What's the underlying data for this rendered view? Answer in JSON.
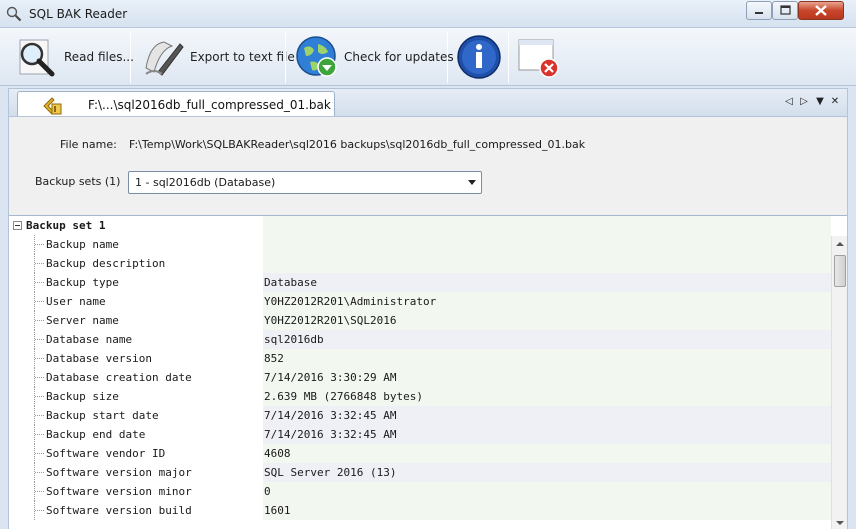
{
  "window": {
    "title": "SQL BAK Reader",
    "app_icon": "magnifier-icon"
  },
  "toolbar": {
    "read_files": "Read files...",
    "export": "Export to text file",
    "check_updates": "Check for updates"
  },
  "tab": {
    "label": "F:\\...\\sql2016db_full_compressed_01.bak"
  },
  "file": {
    "label": "File name:",
    "value": "F:\\Temp\\Work\\SQLBAKReader\\sql2016 backups\\sql2016db_full_compressed_01.bak"
  },
  "backup_sets": {
    "label": "Backup sets (1)",
    "selected": "1 - sql2016db (Database)"
  },
  "tree": {
    "root": "Backup set 1",
    "rows": [
      {
        "name": "Backup name",
        "value": ""
      },
      {
        "name": "Backup description",
        "value": ""
      },
      {
        "name": "Backup type",
        "value": "Database"
      },
      {
        "name": "User name",
        "value": "Y0HZ2012R201\\Administrator"
      },
      {
        "name": "Server name",
        "value": "Y0HZ2012R201\\SQL2016"
      },
      {
        "name": "Database name",
        "value": "sql2016db"
      },
      {
        "name": "Database version",
        "value": "852"
      },
      {
        "name": "Database creation date",
        "value": "7/14/2016 3:30:29 AM"
      },
      {
        "name": "Backup size",
        "value": "2.639 MB (2766848 bytes)"
      },
      {
        "name": "Backup start date",
        "value": "7/14/2016 3:32:45 AM"
      },
      {
        "name": "Backup end date",
        "value": "7/14/2016 3:32:45 AM"
      },
      {
        "name": "Software vendor ID",
        "value": "4608"
      },
      {
        "name": "Software version major",
        "value": "SQL Server 2016 (13)"
      },
      {
        "name": "Software version minor",
        "value": "0"
      },
      {
        "name": "Software version build",
        "value": "1601"
      }
    ]
  },
  "colors": {
    "accent": "#1e6fd0",
    "close_button": "#c9462b"
  }
}
